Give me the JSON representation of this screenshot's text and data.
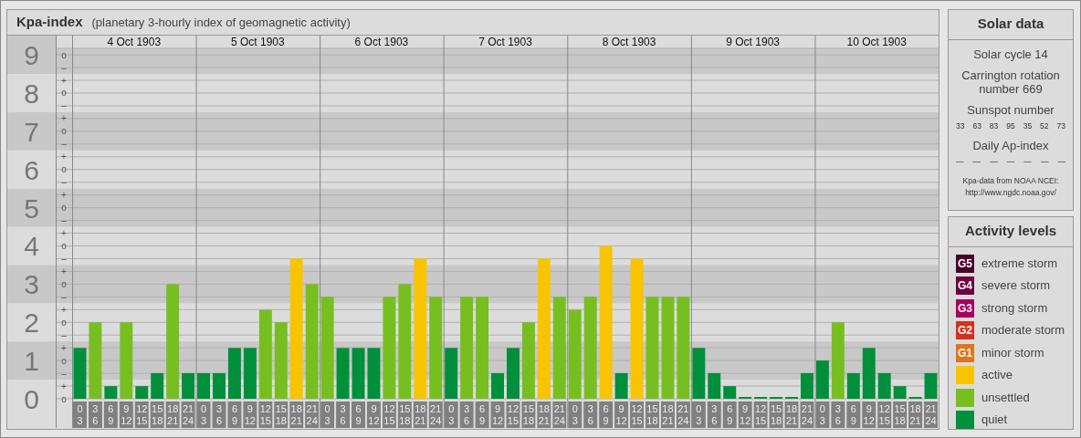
{
  "kpa_panel": {
    "title": "Kpa-index",
    "subtitle": "(planetary 3-hourly index of geomagnetic activity)",
    "subticks": [
      "o",
      "–",
      "+",
      "o",
      "–",
      "+",
      "o",
      "–",
      "+",
      "o",
      "–",
      "+",
      "o",
      "–",
      "+",
      "o",
      "–",
      "+",
      "o",
      "–",
      "+",
      "o",
      "–",
      "+",
      "o",
      "–",
      "+",
      "o"
    ],
    "days": [
      "4 Oct 1903",
      "5 Oct 1903",
      "6 Oct 1903",
      "7 Oct 1903",
      "8 Oct 1903",
      "9 Oct 1903",
      "10 Oct 1903"
    ],
    "chart_data": {
      "type": "bar",
      "ylim": [
        0,
        9.17
      ],
      "yticks": [
        0,
        1,
        2,
        3,
        4,
        5,
        6,
        7,
        8,
        9
      ],
      "grid": true,
      "categories": [
        "0\n3",
        "3\n6",
        "6\n9",
        "9\n12",
        "12\n15",
        "15\n18",
        "18\n21",
        "21\n24",
        "0\n3",
        "3\n6",
        "6\n9",
        "9\n12",
        "12\n15",
        "15\n18",
        "18\n21",
        "21\n24",
        "0\n3",
        "3\n6",
        "6\n9",
        "9\n12",
        "12\n15",
        "15\n18",
        "18\n21",
        "21\n24",
        "0\n3",
        "3\n6",
        "6\n9",
        "9\n12",
        "12\n15",
        "15\n18",
        "18\n21",
        "21\n24",
        "0\n3",
        "3\n6",
        "6\n9",
        "9\n12",
        "12\n15",
        "15\n18",
        "18\n21",
        "21\n24",
        "0\n3",
        "3\n6",
        "6\n9",
        "9\n12",
        "12\n15",
        "15\n18",
        "18\n21",
        "21\n24",
        "0\n3",
        "3\n6",
        "6\n9",
        "9\n12",
        "12\n15",
        "15\n18",
        "18\n21",
        "21\n24"
      ],
      "series": [
        {
          "color": "#008f3b",
          "values": [
            1.33,
            null,
            0.33,
            null,
            0.33,
            0.67,
            null,
            0.67,
            0.67,
            0.67,
            1.33,
            1.33,
            null,
            null,
            null,
            null,
            null,
            1.33,
            1.33,
            1.33,
            null,
            null,
            null,
            null,
            1.33,
            null,
            null,
            0.67,
            1.33,
            null,
            null,
            null,
            null,
            null,
            null,
            0.67,
            null,
            null,
            null,
            null,
            1.33,
            0.67,
            0.33,
            0,
            0,
            0,
            0,
            0.67,
            1,
            null,
            0.67,
            1.33,
            0.67,
            0.33,
            0,
            0.67
          ]
        },
        {
          "color": "#77bf21",
          "values": [
            null,
            2,
            null,
            2,
            null,
            null,
            3,
            null,
            null,
            null,
            null,
            null,
            2.33,
            2,
            null,
            3,
            2.67,
            null,
            null,
            null,
            2.67,
            3,
            null,
            2.67,
            null,
            2.67,
            2.67,
            null,
            null,
            2,
            null,
            2.67,
            2.33,
            2.67,
            null,
            null,
            null,
            2.67,
            2.67,
            2.67,
            null,
            null,
            null,
            null,
            null,
            null,
            null,
            null,
            null,
            2,
            null,
            null,
            null,
            null,
            null,
            null
          ]
        },
        {
          "color": "#f8c400",
          "values": [
            null,
            null,
            null,
            null,
            null,
            null,
            null,
            null,
            null,
            null,
            null,
            null,
            null,
            null,
            3.67,
            null,
            null,
            null,
            null,
            null,
            null,
            null,
            3.67,
            null,
            null,
            null,
            null,
            null,
            null,
            null,
            3.67,
            null,
            null,
            null,
            4,
            null,
            3.67,
            null,
            null,
            null,
            null,
            null,
            null,
            null,
            null,
            null,
            null,
            null,
            null,
            null,
            null,
            null,
            null,
            null,
            null,
            null
          ]
        }
      ]
    }
  },
  "solar_data": {
    "title": "Solar data",
    "solar_cycle": "Solar cycle 14",
    "carrington": "Carrington rotation number 669",
    "sunspot_label": "Sunspot number",
    "sunspot_numbers": [
      "33",
      "63",
      "83",
      "95",
      "35",
      "52",
      "73"
    ],
    "ap_label": "Daily Ap-index",
    "ap_values": [
      "—",
      "—",
      "—",
      "—",
      "—",
      "—",
      "—"
    ],
    "source_lines": [
      "Kpa-data from NOAA NCEI:",
      "http://www.ngdc.noaa.gov/"
    ]
  },
  "activity_levels": {
    "title": "Activity levels",
    "items": [
      {
        "badge": "G5",
        "label": "extreme storm",
        "color": "#4a0028"
      },
      {
        "badge": "G4",
        "label": "severe storm",
        "color": "#6e0040"
      },
      {
        "badge": "G3",
        "label": "strong storm",
        "color": "#a8005e"
      },
      {
        "badge": "G2",
        "label": "moderate storm",
        "color": "#d7301c"
      },
      {
        "badge": "G1",
        "label": "minor storm",
        "color": "#e0761a"
      },
      {
        "label": "active",
        "color": "#f8c400"
      },
      {
        "label": "unsettled",
        "color": "#77bf21"
      },
      {
        "label": "quiet",
        "color": "#008f3b"
      }
    ]
  }
}
